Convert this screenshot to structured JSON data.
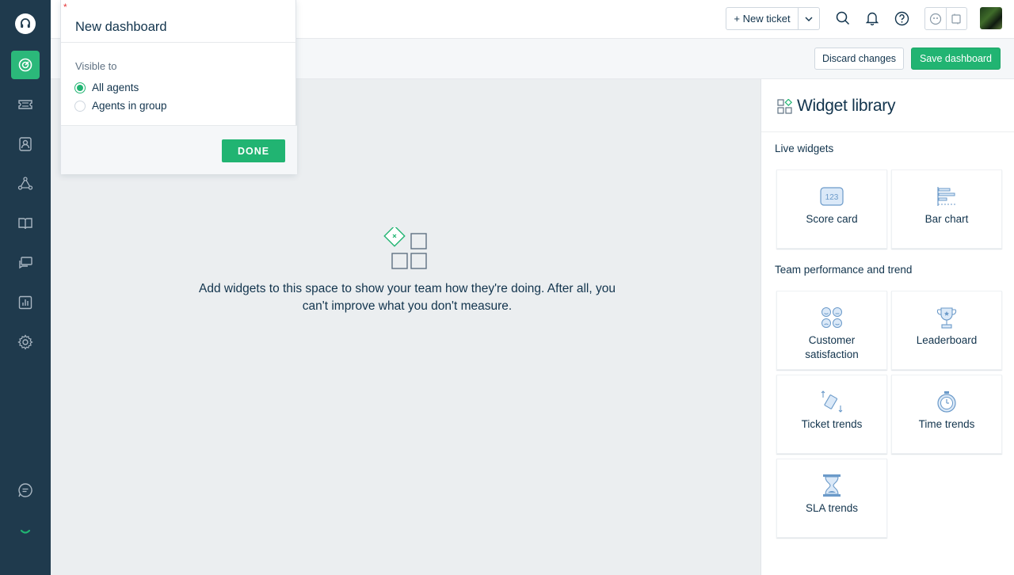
{
  "topbar": {
    "new_ticket_label": "+ New ticket"
  },
  "actions": {
    "discard_label": "Discard changes",
    "save_label": "Save dashboard"
  },
  "popover": {
    "required_mark": "*",
    "title": "New dashboard",
    "visible_to_label": "Visible to",
    "options": [
      {
        "label": "All agents",
        "selected": true
      },
      {
        "label": "Agents in group",
        "selected": false
      }
    ],
    "done_label": "DONE"
  },
  "empty_state": {
    "message": "Add widgets to this space to show your team how they're doing. After all, you can't improve what you don't measure."
  },
  "library": {
    "title": "Widget library",
    "sections": [
      {
        "title": "Live widgets"
      },
      {
        "title": "Team performance and trend"
      }
    ],
    "widgets": [
      {
        "label": "Score card",
        "icon": "score-card-icon"
      },
      {
        "label": "Bar chart",
        "icon": "bar-chart-icon"
      },
      {
        "label": "Customer satisfaction",
        "icon": "customer-satisfaction-icon"
      },
      {
        "label": "Leaderboard",
        "icon": "trophy-icon"
      },
      {
        "label": "Ticket trends",
        "icon": "ticket-trends-icon"
      },
      {
        "label": "Time trends",
        "icon": "stopwatch-icon"
      },
      {
        "label": "SLA trends",
        "icon": "hourglass-icon"
      }
    ],
    "score_card_digits": "123"
  },
  "colors": {
    "rail": "#1f3a4d",
    "accent": "#21b472",
    "text": "#12344d"
  }
}
